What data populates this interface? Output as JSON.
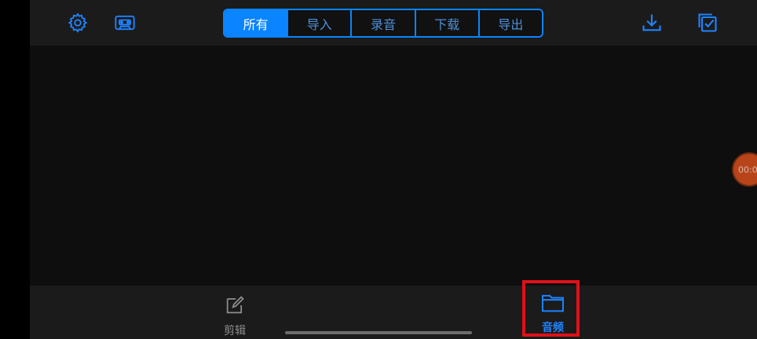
{
  "topbar": {
    "settings_icon": "gear-icon",
    "cassette_icon": "cassette-icon",
    "download_icon": "download-icon",
    "select_icon": "checkbox-select-icon",
    "filters": [
      {
        "label": "所有",
        "active": true
      },
      {
        "label": "导入",
        "active": false
      },
      {
        "label": "录音",
        "active": false
      },
      {
        "label": "下载",
        "active": false
      },
      {
        "label": "导出",
        "active": false
      }
    ]
  },
  "floating_timer": {
    "text": "00:0"
  },
  "bottom_tabs": {
    "edit": {
      "label": "剪辑",
      "icon": "edit-icon"
    },
    "audio": {
      "label": "音频",
      "icon": "folder-icon",
      "active": true
    }
  },
  "colors": {
    "accent": "#0a84ff",
    "background": "#0e0e0e",
    "bar": "#1b1b1b",
    "highlight": "#e0101a",
    "timer": "#b8441a"
  }
}
